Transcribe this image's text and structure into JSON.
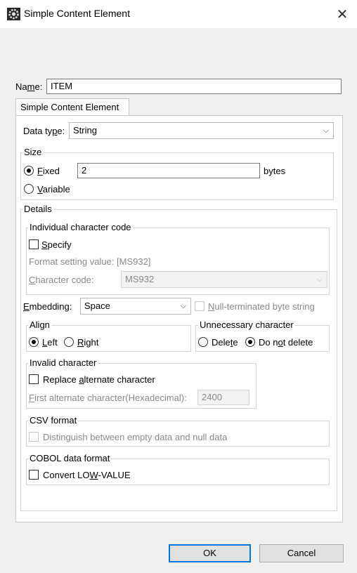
{
  "window": {
    "title": "Simple Content Element",
    "close_glyph": "✕",
    "icon": "gear-app-icon"
  },
  "name_field": {
    "label_before": "Na",
    "label_mnemonic": "m",
    "label_after": "e:",
    "value": "ITEM"
  },
  "tab": {
    "label": "Simple Content Element"
  },
  "data_type": {
    "label_before": "Data ty",
    "label_mnemonic": "p",
    "label_after": "e:",
    "value": "String"
  },
  "size": {
    "title": "Size",
    "fixed_mnemonic": "F",
    "fixed_rest": "ixed",
    "fixed_checked": true,
    "fixed_value": "2",
    "unit": "bytes",
    "variable_mnemonic": "V",
    "variable_rest": "ariable",
    "variable_checked": false
  },
  "details": {
    "title": "Details",
    "char_code_group": {
      "title": "Individual character code",
      "specify_mnemonic": "S",
      "specify_rest": "pecify",
      "specify_checked": false,
      "format_setting_text": "Format setting value: [MS932]",
      "char_code_mnemonic": "C",
      "char_code_rest": "haracter code:",
      "char_code_value": "MS932"
    },
    "embedding": {
      "label_mnemonic": "E",
      "label_rest": "mbedding:",
      "value": "Space",
      "null_term_mnemonic": "N",
      "null_term_rest": "ull-terminated byte string",
      "null_term_checked": false
    },
    "align": {
      "title": "Align",
      "left_mnemonic": "L",
      "left_rest": "eft",
      "left_checked": true,
      "right_mnemonic": "R",
      "right_rest": "ight",
      "right_checked": false
    },
    "unnecessary": {
      "title": "Unnecessary character",
      "delete_before": "Dele",
      "delete_mnemonic": "t",
      "delete_after": "e",
      "delete_checked": false,
      "donot_before": "Do n",
      "donot_mnemonic": "o",
      "donot_after": "t delete",
      "donot_checked": true
    },
    "invalid": {
      "title": "Invalid character",
      "replace_before": "Replace ",
      "replace_mnemonic": "a",
      "replace_after": "lternate character",
      "replace_checked": false,
      "first_alt_mnemonic": "F",
      "first_alt_rest": "irst alternate character(Hexadecimal):",
      "first_alt_value": "2400"
    },
    "csv": {
      "title": "CSV format",
      "distinguish_label": "Distinguish between empty data and null data",
      "distinguish_checked": false
    },
    "cobol": {
      "title": "COBOL data format",
      "convert_before": "Convert LO",
      "convert_mnemonic": "W",
      "convert_after": "-VALUE",
      "convert_checked": false
    }
  },
  "buttons": {
    "ok": "OK",
    "cancel": "Cancel"
  }
}
